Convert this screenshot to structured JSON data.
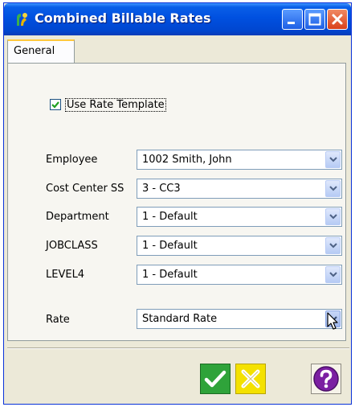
{
  "window": {
    "title": "Combined Billable Rates"
  },
  "tabs": [
    {
      "label": "General",
      "selected": true
    }
  ],
  "options": {
    "use_rate_template_label": "Use Rate Template",
    "use_rate_template_checked": true
  },
  "fields": [
    {
      "label": "Employee",
      "value": "1002 Smith, John"
    },
    {
      "label": "Cost Center SS",
      "value": "3 - CC3"
    },
    {
      "label": "Department",
      "value": "1 - Default"
    },
    {
      "label": "JOBCLASS",
      "value": "1 - Default"
    },
    {
      "label": "LEVEL4",
      "value": "1 - Default"
    },
    {
      "label": "Rate",
      "value": "Standard Rate"
    }
  ],
  "icons": {
    "app": "app-icon",
    "minimize": "minimize-icon",
    "maximize": "maximize-icon",
    "close": "close-icon",
    "ok": "checkmark-icon",
    "cancel": "x-icon",
    "help": "question-mark-icon",
    "dropdown": "chevron-down-icon"
  },
  "colors": {
    "title_bar": "#0050e0",
    "ok_button": "#2fa33a",
    "cancel_button": "#f4e100",
    "help_button": "#7b1fa2"
  }
}
